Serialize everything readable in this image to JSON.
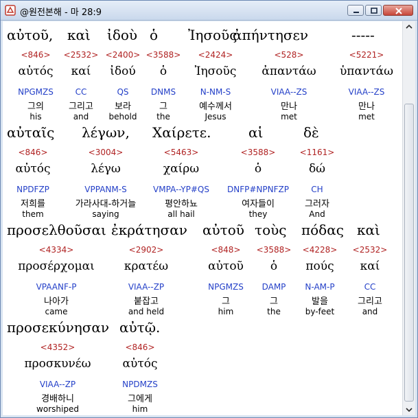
{
  "window": {
    "title": "@원전본해 - 마 28:9",
    "icon": "bible-app-icon"
  },
  "words": [
    {
      "greek": "αὐτοῦ,",
      "num": "<846>",
      "lemma": "αὐτός",
      "parse": "NPGMZS",
      "ko": "그의",
      "en": "his"
    },
    {
      "greek": "καὶ",
      "num": "<2532>",
      "lemma": "καί",
      "parse": "CC",
      "ko": "그리고",
      "en": "and"
    },
    {
      "greek": "ἰδοὺ",
      "num": "<2400>",
      "lemma": "ἰδού",
      "parse": "QS",
      "ko": "보라",
      "en": "behold"
    },
    {
      "greek": "ὁ",
      "num": "<3588>",
      "lemma": "ὁ",
      "parse": "DNMS",
      "ko": "그",
      "en": "the"
    },
    {
      "greek": "Ἰησοῦς",
      "num": "<2424>",
      "lemma": "Ἰησοῦς",
      "parse": "N-NM-S",
      "ko": "예수께서",
      "en": "Jesus"
    },
    {
      "greek": "ἀπήντησεν",
      "num": "<528>",
      "lemma": "ἀπαντάω",
      "parse": "VIAA--ZS",
      "ko": "만나",
      "en": "met"
    },
    {
      "greek": "-----",
      "num": "<5221>",
      "lemma": "ὑπαντάω",
      "parse": "VIAA--ZS",
      "ko": "만나",
      "en": "met"
    },
    {
      "greek": "αὐταῖς",
      "num": "<846>",
      "lemma": "αὐτός",
      "parse": "NPDFZP",
      "ko": "저희를",
      "en": "them"
    },
    {
      "greek": "λέγων,",
      "num": "<3004>",
      "lemma": "λέγω",
      "parse": "VPPANM-S",
      "ko": "가라사대-하거늘",
      "en": "saying"
    },
    {
      "greek": "Χαίρετε.",
      "num": "<5463>",
      "lemma": "χαίρω",
      "parse": "VMPA--YP#QS",
      "ko": "평안하뇨",
      "en": "all hail"
    },
    {
      "greek": "αἱ",
      "num": "<3588>",
      "lemma": "ὁ",
      "parse": "DNFP#NPNFZP",
      "ko": "여자들이",
      "en": "they"
    },
    {
      "greek": "δὲ",
      "num": "<1161>",
      "lemma": "δώ",
      "parse": "CH",
      "ko": "그러자",
      "en": "And"
    },
    {
      "greek": "προσελθοῦσαι",
      "num": "<4334>",
      "lemma": "προσέρχομαι",
      "parse": "VPAANF-P",
      "ko": "나아가",
      "en": "came"
    },
    {
      "greek": "ἐκράτησαν",
      "num": "<2902>",
      "lemma": "κρατέω",
      "parse": "VIAA--ZP",
      "ko": "붙잡고",
      "en": "and held"
    },
    {
      "greek": "αὐτοῦ",
      "num": "<848>",
      "lemma": "αὐτοῦ",
      "parse": "NPGMZS",
      "ko": "그",
      "en": "him"
    },
    {
      "greek": "τοὺς",
      "num": "<3588>",
      "lemma": "ὁ",
      "parse": "DAMP",
      "ko": "그",
      "en": "the"
    },
    {
      "greek": "πόδας",
      "num": "<4228>",
      "lemma": "πούς",
      "parse": "N-AM-P",
      "ko": "발을",
      "en": "by-feet"
    },
    {
      "greek": "καὶ",
      "num": "<2532>",
      "lemma": "καί",
      "parse": "CC",
      "ko": "그리고",
      "en": "and"
    },
    {
      "greek": "προσεκύνησαν",
      "num": "<4352>",
      "lemma": "προσκυνέω",
      "parse": "VIAA--ZP",
      "ko": "경배하니",
      "en": "worshiped"
    },
    {
      "greek": "αὐτῷ.",
      "num": "<846>",
      "lemma": "αὐτός",
      "parse": "NPDMZS",
      "ko": "그에게",
      "en": "him"
    }
  ],
  "colors": {
    "strongs_number": "#b02222",
    "parsing_code": "#2440c8",
    "text": "#000000"
  }
}
